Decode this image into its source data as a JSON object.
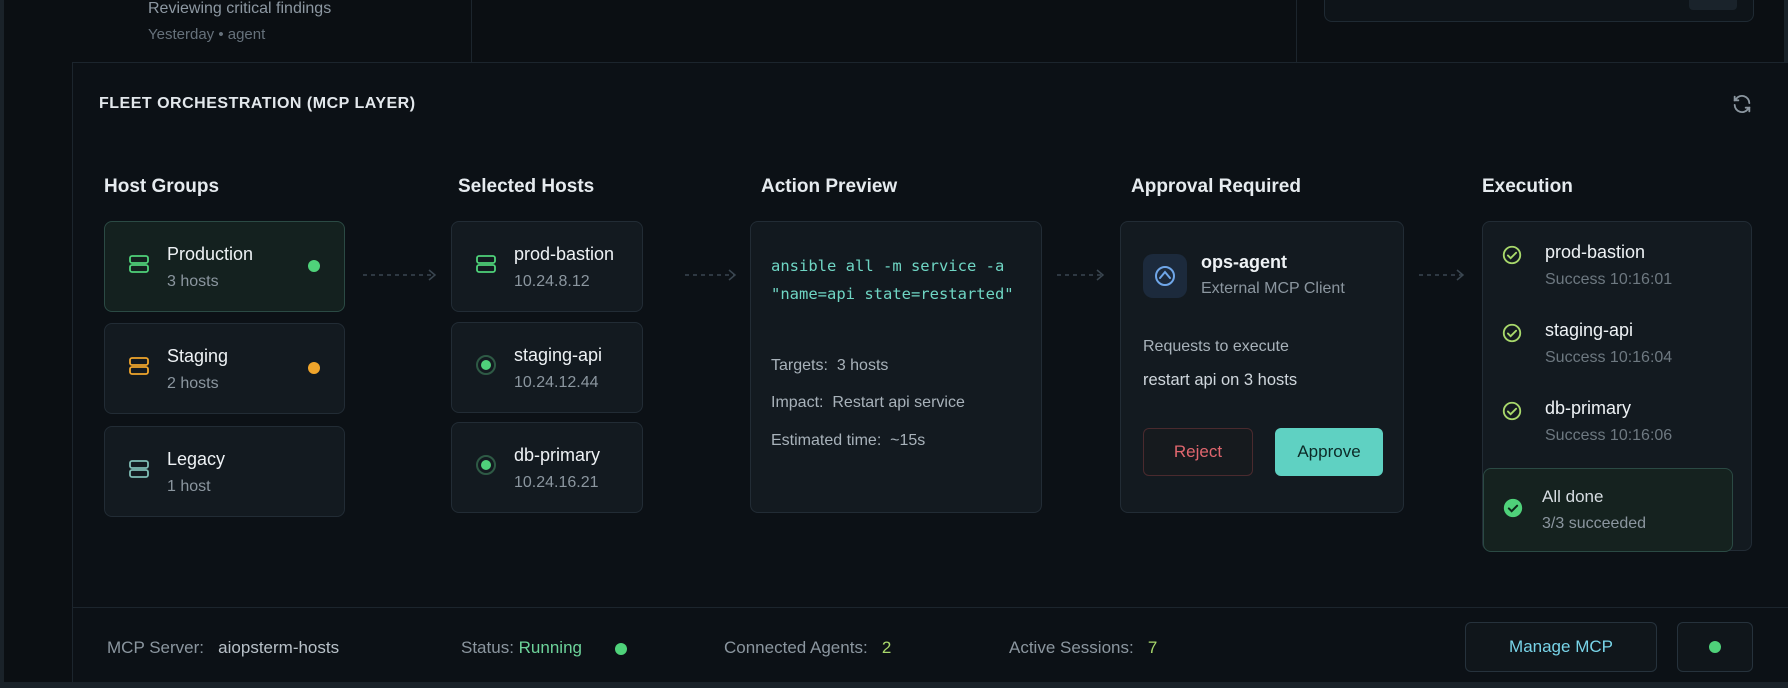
{
  "top": {
    "item_title": "Reviewing critical findings",
    "item_meta": "Yesterday • agent"
  },
  "section": {
    "title": "FLEET ORCHESTRATION (MCP LAYER)"
  },
  "columns": {
    "host_groups": "Host Groups",
    "selected_hosts": "Selected Hosts",
    "action_preview": "Action Preview",
    "approval_required": "Approval Required",
    "execution": "Execution"
  },
  "host_groups": [
    {
      "name": "Production",
      "count": "3 hosts",
      "status_color": "#4fd27a"
    },
    {
      "name": "Staging",
      "count": "2 hosts",
      "status_color": "#f0a52b"
    },
    {
      "name": "Legacy",
      "count": "1 host"
    }
  ],
  "selected_hosts": [
    {
      "name": "prod-bastion",
      "ip": "10.24.8.12"
    },
    {
      "name": "staging-api",
      "ip": "10.24.12.44"
    },
    {
      "name": "db-primary",
      "ip": "10.24.16.21"
    }
  ],
  "action_preview": {
    "code_line1": "ansible all -m service -a",
    "code_line2": "\"name=api state=restarted\"",
    "targets_label": "Targets:",
    "targets_value": "3 hosts",
    "impact_label": "Impact:",
    "impact_value": "Restart api service",
    "time_label": "Estimated time:",
    "time_value": "~15s"
  },
  "approval": {
    "agent_name": "ops-agent",
    "agent_sub": "External MCP Client",
    "request_line1": "Requests to execute",
    "request_line2": "restart api on 3 hosts",
    "reject_label": "Reject",
    "approve_label": "Approve"
  },
  "execution": {
    "rows": [
      {
        "name": "prod-bastion",
        "status": "Success 10:16:01"
      },
      {
        "name": "staging-api",
        "status": "Success 10:16:04"
      },
      {
        "name": "db-primary",
        "status": "Success 10:16:06"
      }
    ],
    "done_title": "All done",
    "done_sub": "3/3 succeeded"
  },
  "status_bar": {
    "server_label": "MCP Server:",
    "server_value": "aiopsterm-hosts",
    "status_label": "Status:",
    "status_value": "Running",
    "agents_label": "Connected Agents:",
    "agents_value": "2",
    "sessions_label": "Active Sessions:",
    "sessions_value": "7",
    "manage_label": "Manage MCP"
  },
  "colors": {
    "accent": "#5fd1c2",
    "success": "#4fd27a",
    "warning": "#f0a52b",
    "danger": "#e0666e"
  }
}
